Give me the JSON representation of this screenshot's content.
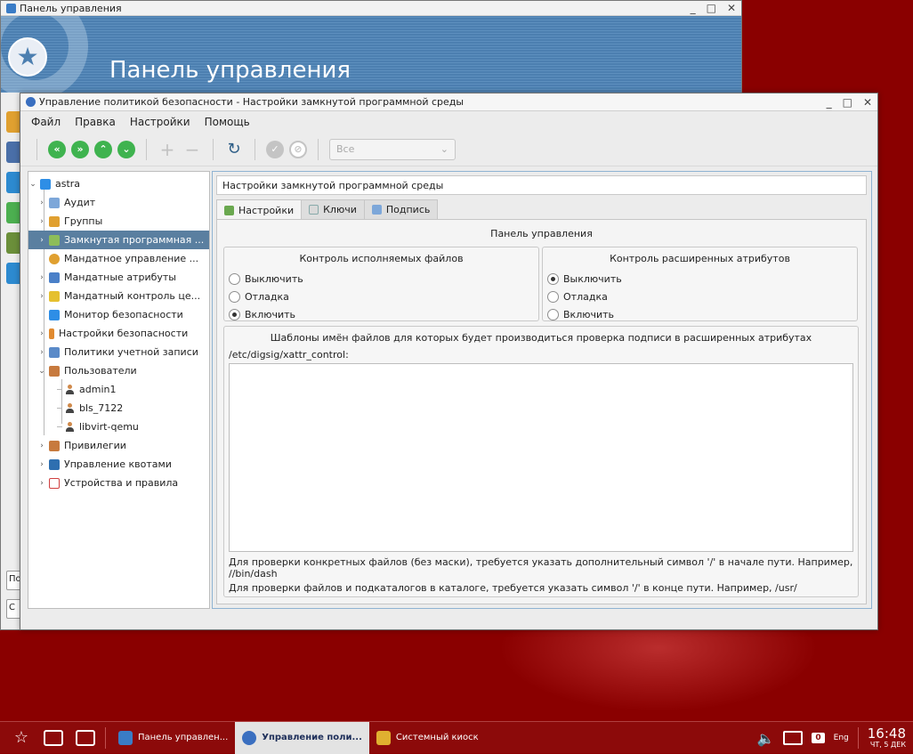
{
  "control_panel": {
    "window_title": "Панель управления",
    "banner_title": "Панель управления",
    "left_stub_1": "По",
    "left_stub_2": "С"
  },
  "window": {
    "title": "Управление политикой безопасности - Настройки замкнутой программной среды"
  },
  "window_controls": {
    "minimize": "_",
    "maximize": "□",
    "close": "✕"
  },
  "menu": [
    "Файл",
    "Правка",
    "Настройки",
    "Помощь"
  ],
  "toolbar": {
    "filter_value": "Все",
    "filter_arrow": "⌄"
  },
  "tree": {
    "root": "astra",
    "items": [
      "Аудит",
      "Группы",
      "Замкнутая программная ...",
      "Мандатное управление ...",
      "Мандатные атрибуты",
      "Мандатный контроль це...",
      "Монитор безопасности",
      "Настройки безопасности",
      "Политики учетной записи",
      "Пользователи",
      "admin1",
      "bls_7122",
      "libvirt-qemu",
      "Привилегии",
      "Управление квотами",
      "Устройства и правила"
    ]
  },
  "content": {
    "header": "Настройки замкнутой программной среды",
    "tabs": [
      "Настройки",
      "Ключи",
      "Подпись"
    ],
    "panel_title": "Панель управления",
    "exec_group": {
      "title": "Контроль исполняемых файлов",
      "options": [
        "Выключить",
        "Отладка",
        "Включить"
      ],
      "selected": "Включить"
    },
    "xattr_group": {
      "title": "Контроль расширенных атрибутов",
      "options": [
        "Выключить",
        "Отладка",
        "Включить"
      ],
      "selected": "Выключить"
    },
    "templates": {
      "title": "Шаблоны имён файлов для которых будет производиться проверка подписи в расширенных атрибутах",
      "path_label": "/etc/digsig/xattr_control:",
      "value": "",
      "hint_1": "Для проверки конкретных файлов (без маски), требуется указать дополнительный символ '/' в начале пути. Например, //bin/dash",
      "hint_2": "Для проверки файлов и подкаталогов в каталоге, требуется указать символ '/' в конце пути. Например, /usr/"
    }
  },
  "taskbar": {
    "tasks": [
      "Панель управлен...",
      "Управление поли...",
      "Системный киоск"
    ],
    "badge": "0",
    "lang": "Eng",
    "time": "16:48",
    "date": "ЧТ, 5 ДЕК"
  },
  "colors": {
    "desktop": "#8a0000",
    "selection": "#5a7fa0",
    "accent_green": "#3fb34f",
    "banner": "#4c7fb0"
  }
}
